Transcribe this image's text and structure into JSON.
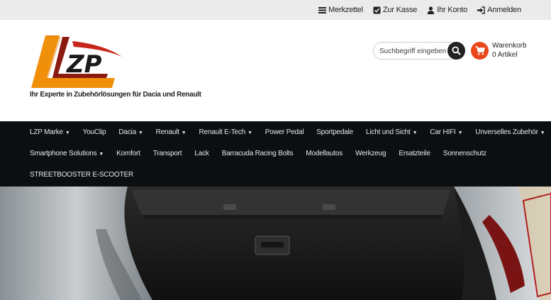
{
  "topbar": {
    "links": [
      {
        "label": "Merkzettel",
        "icon": "list-icon"
      },
      {
        "label": "Zur Kasse",
        "icon": "checkbox-icon"
      },
      {
        "label": "Ihr Konto",
        "icon": "user-icon"
      },
      {
        "label": "Anmelden",
        "icon": "sign-in-icon"
      }
    ]
  },
  "header": {
    "logo_text": "ZP",
    "tagline": "Ihr Experte in Zubehörlösungen für Dacia und Renault",
    "search_placeholder": "Suchbegriff eingeben",
    "cart": {
      "line1": "Warenkorb",
      "line2": "0 Artikel"
    }
  },
  "colors": {
    "accent": "#e8471c",
    "logo_orange": "#f0900a",
    "nav_bg": "#0c0f12"
  },
  "nav": {
    "row1": [
      {
        "label": "LZP Marke",
        "dropdown": true
      },
      {
        "label": "YouClip",
        "dropdown": false
      },
      {
        "label": "Dacia",
        "dropdown": true
      },
      {
        "label": "Renault",
        "dropdown": true
      },
      {
        "label": "Renault E-Tech",
        "dropdown": true
      },
      {
        "label": "Power Pedal",
        "dropdown": false
      },
      {
        "label": "Sportpedale",
        "dropdown": false
      },
      {
        "label": "Licht und Sicht",
        "dropdown": true
      },
      {
        "label": "Car HIFI",
        "dropdown": true
      },
      {
        "label": "Unverselles Zubehör",
        "dropdown": true
      }
    ],
    "row2": [
      {
        "label": "Smartphone Solutions",
        "dropdown": true
      },
      {
        "label": "Komfort",
        "dropdown": false
      },
      {
        "label": "Transport",
        "dropdown": false
      },
      {
        "label": "Lack",
        "dropdown": false
      },
      {
        "label": "Barracuda Racing Bolts",
        "dropdown": false
      },
      {
        "label": "Modellautos",
        "dropdown": false
      },
      {
        "label": "Werkzeug",
        "dropdown": false
      },
      {
        "label": "Ersatzteile",
        "dropdown": false
      },
      {
        "label": "Sonnenschutz",
        "dropdown": false
      }
    ],
    "row3": [
      {
        "label": "STREETBOOSTER E-SCOOTER",
        "dropdown": false
      }
    ]
  }
}
